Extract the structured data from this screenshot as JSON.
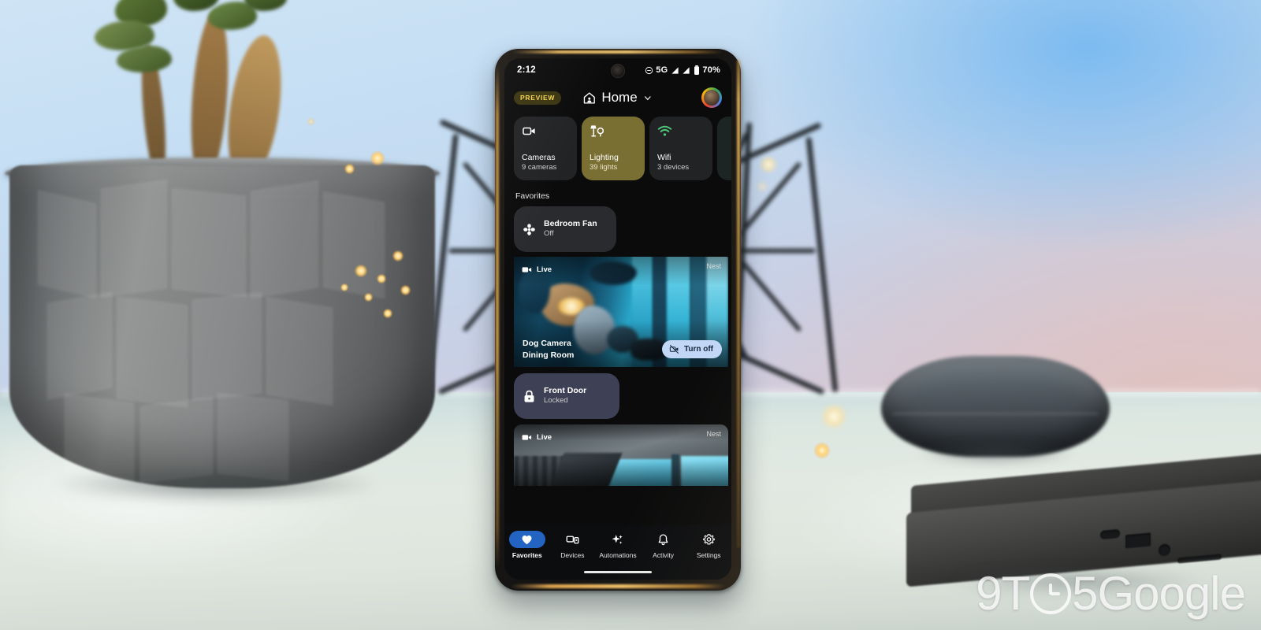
{
  "photo": {
    "watermark": {
      "part1": "9T",
      "clock_icon": "clock-o-icon",
      "part2": "5Google"
    },
    "scene_objects": {
      "planter": "gray-faceted-planter-with-plant",
      "lantern": "black-wire-geometric-lantern",
      "speaker": "nest-mini-speaker",
      "laptop": "closed-dark-laptop",
      "fairy_lights": "warm-string-lights"
    }
  },
  "phone": {
    "statusbar": {
      "time": "2:12",
      "dnd_icon": "do-not-disturb-icon",
      "network": "5G",
      "signal_icon": "signal-bars-icon",
      "signal_icon_2": "signal-bars-icon",
      "battery_icon": "battery-icon",
      "battery_level": "70%"
    },
    "header": {
      "preview_badge": "PREVIEW",
      "home_icon": "home-person-icon",
      "title": "Home",
      "chevron_icon": "chevron-down-icon",
      "avatar": "user-avatar"
    },
    "chips": [
      {
        "icon": "video-camera-icon",
        "name": "Cameras",
        "sub": "9 cameras",
        "state": "dim"
      },
      {
        "icon": "lamp-icon",
        "name": "Lighting",
        "sub": "39 lights",
        "state": "active"
      },
      {
        "icon": "wifi-icon",
        "name": "Wifi",
        "sub": "3 devices",
        "state": "dim"
      }
    ],
    "favorites_label": "Favorites",
    "tiles": [
      {
        "icon": "fan-icon",
        "name": "Bedroom Fan",
        "status": "Off",
        "style": "dark"
      },
      {
        "icon": "lock-icon",
        "name": "Front Door",
        "status": "Locked",
        "style": "lock"
      }
    ],
    "cameras": [
      {
        "live_label": "Live",
        "live_icon": "video-camera-icon",
        "brand": "Nest",
        "name": "Dog Camera",
        "room": "Dining Room",
        "action_label": "Turn off",
        "action_icon": "camera-off-icon"
      },
      {
        "live_label": "Live",
        "live_icon": "video-camera-icon",
        "brand": "Nest"
      }
    ],
    "nav": [
      {
        "icon": "heart-icon",
        "label": "Favorites",
        "active": true
      },
      {
        "icon": "devices-icon",
        "label": "Devices",
        "active": false
      },
      {
        "icon": "sparkle-icon",
        "label": "Automations",
        "active": false
      },
      {
        "icon": "bell-icon",
        "label": "Activity",
        "active": false
      },
      {
        "icon": "gear-icon",
        "label": "Settings",
        "active": false
      }
    ]
  },
  "colors": {
    "accent_blue": "#2364c2",
    "active_chip": "#7a6f33",
    "preview_text": "#f2d14e",
    "lock_tile": "#3e4155",
    "turn_off_button": "#c2d6f5",
    "wifi_green": "#4ec77a"
  }
}
